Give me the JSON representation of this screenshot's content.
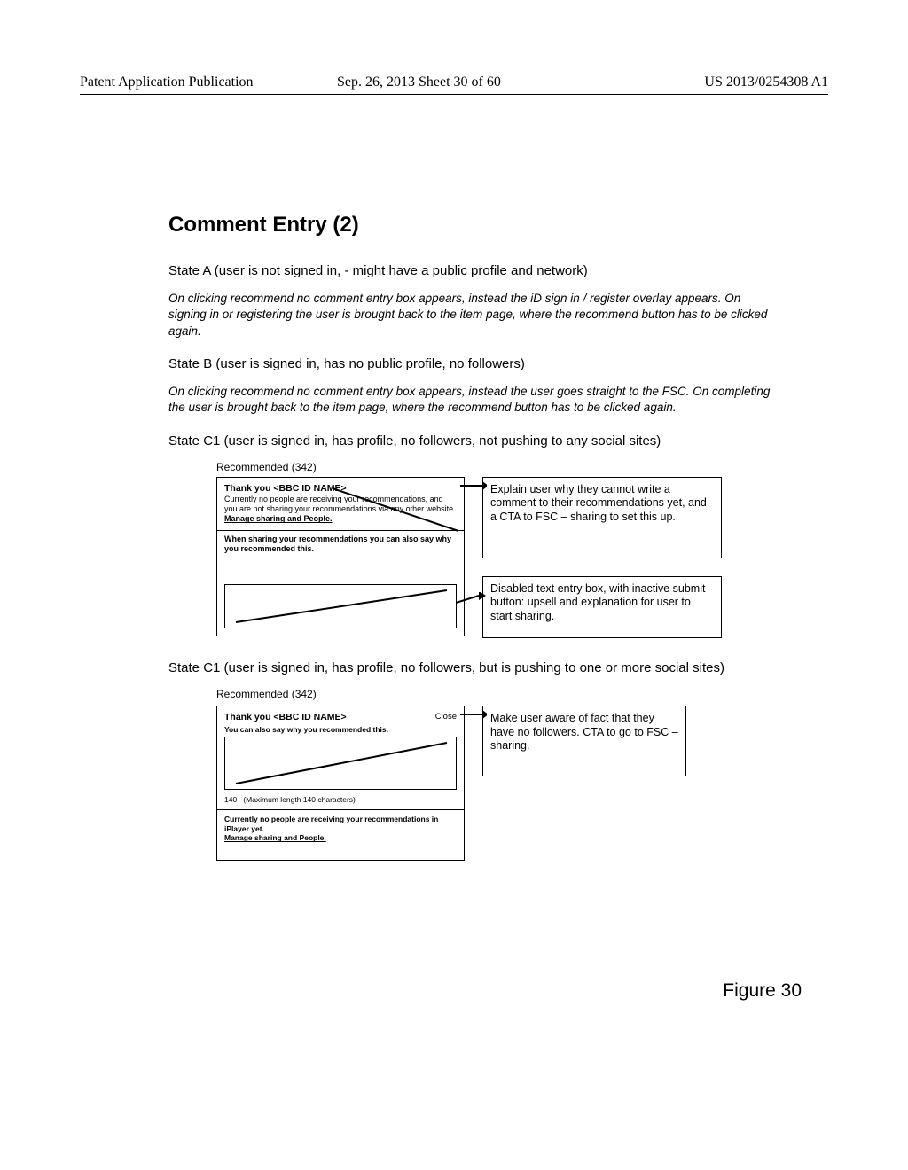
{
  "header": {
    "left": "Patent Application Publication",
    "mid": "Sep. 26, 2013  Sheet 30 of 60",
    "right": "US 2013/0254308 A1"
  },
  "title": "Comment Entry (2)",
  "stateA_heading": "State A (user is not signed in, - might have a public profile and network)",
  "stateA_para": "On clicking recommend no comment entry box appears, instead the iD sign in / register overlay appears. On signing in or registering the user is brought back to the item page, where the recommend button has to be clicked again.",
  "stateB_heading": "State B (user is signed in, has no public profile, no followers)",
  "stateB_para": "On clicking recommend no comment entry box appears, instead the user goes straight to the FSC. On completing the user is brought back to the item page, where the recommend button has to be clicked again.",
  "stateC1a_heading": "State C1 (user is signed in, has  profile, no followers, not pushing to any social sites)",
  "rec_caption": "Recommended (342)",
  "box1": {
    "thank": "Thank you <BBC ID NAME>",
    "currently": "Currently no people are receiving your recommendations, and you are not sharing your recommendations via any other website.",
    "manage": "Manage sharing and People.",
    "when": "When sharing your recommendations you can also say why you recommended this."
  },
  "callout1a": "Explain user why they cannot write a comment to their recommendations yet, and a CTA to FSC – sharing to set this up.",
  "callout1b": "Disabled text entry box, with inactive submit button: upsell and explanation for user to start sharing.",
  "stateC1b_heading": "State C1 (user is signed in, has  profile, no followers, but is pushing to one or more social sites)",
  "box2": {
    "thank": "Thank you <BBC ID NAME>",
    "close": "Close",
    "sub": "You can also say why you recommended this.",
    "charcount": "140",
    "charlabel": "(Maximum length 140 characters)",
    "currently": "Currently no people are receiving your recommendations in iPlayer yet.",
    "manage": "Manage sharing and People."
  },
  "callout2": "Make user aware of fact that they have no followers. CTA to go to FSC – sharing.",
  "figure_caption": "Figure 30"
}
